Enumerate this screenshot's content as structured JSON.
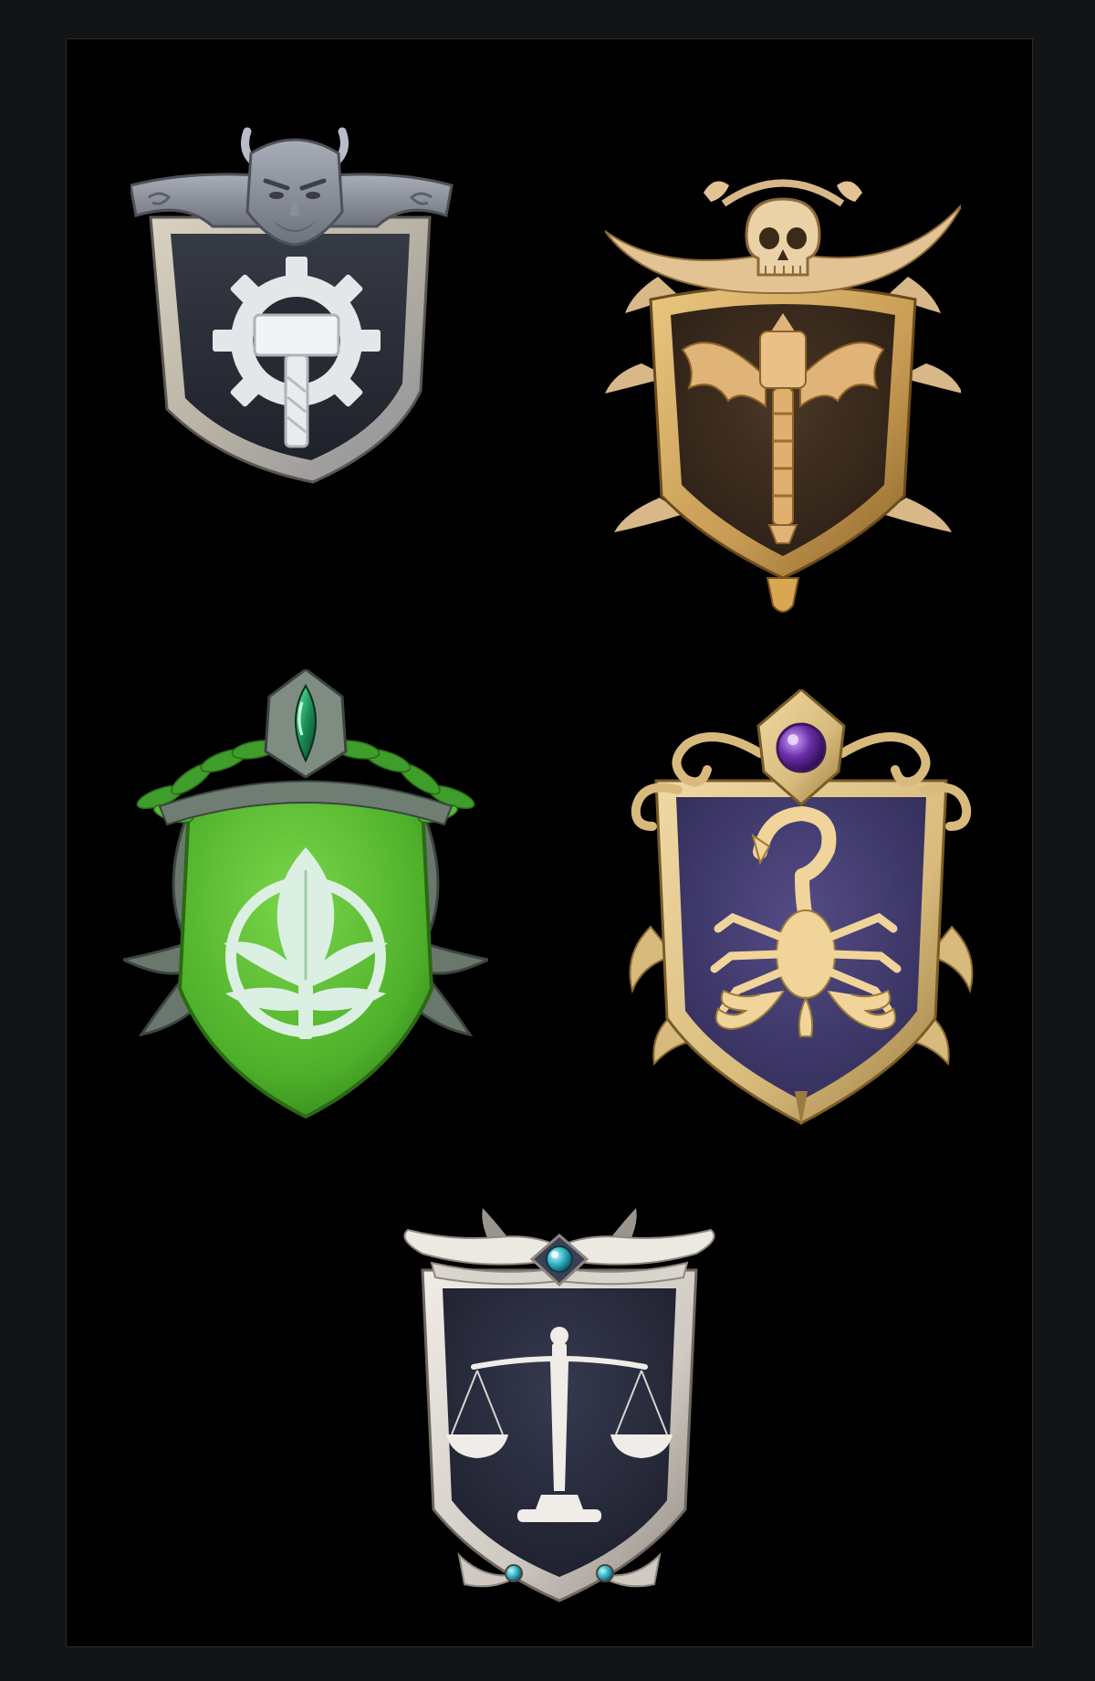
{
  "sheet": {
    "background": "#000000",
    "border_color": "#2a2b2e",
    "outer_background": "#131416"
  },
  "crests": [
    {
      "name": "iron-gear-hammer-crest",
      "top_ornament": "horned-stone-face",
      "emblem": "gear-hammer",
      "colors": {
        "frame": "#b8b2a4",
        "field": "#2b2f38",
        "emblem": "#e9ecef",
        "ornament": "#8a8f99"
      }
    },
    {
      "name": "bone-winged-hammer-crest",
      "top_ornament": "skull-horns",
      "emblem": "winged-hammer",
      "colors": {
        "frame": "#c69a52",
        "field": "#3a2b1f",
        "emblem": "#e0b478",
        "ornament": "#d8b888"
      }
    },
    {
      "name": "nature-leaf-crest",
      "top_ornament": "emerald-gem-laurel",
      "emblem": "leaf-circle",
      "colors": {
        "frame": "#6f7d72",
        "field": "#4eb02a",
        "emblem": "#dcefe3",
        "ornament": "#3f9d2c",
        "gem": "#1c8f57"
      }
    },
    {
      "name": "scorpion-crest",
      "top_ornament": "amethyst-gem-scrolls",
      "emblem": "scorpion",
      "colors": {
        "frame": "#d8bb7c",
        "field": "#3e3868",
        "emblem": "#f0d49a",
        "gem": "#6a2ea8"
      }
    },
    {
      "name": "justice-scales-crest",
      "top_ornament": "winged-eye",
      "emblem": "balance-scales",
      "colors": {
        "frame": "#cfc9c2",
        "field": "#262838",
        "emblem": "#f0ede8",
        "gem": "#36b5c8"
      }
    }
  ]
}
